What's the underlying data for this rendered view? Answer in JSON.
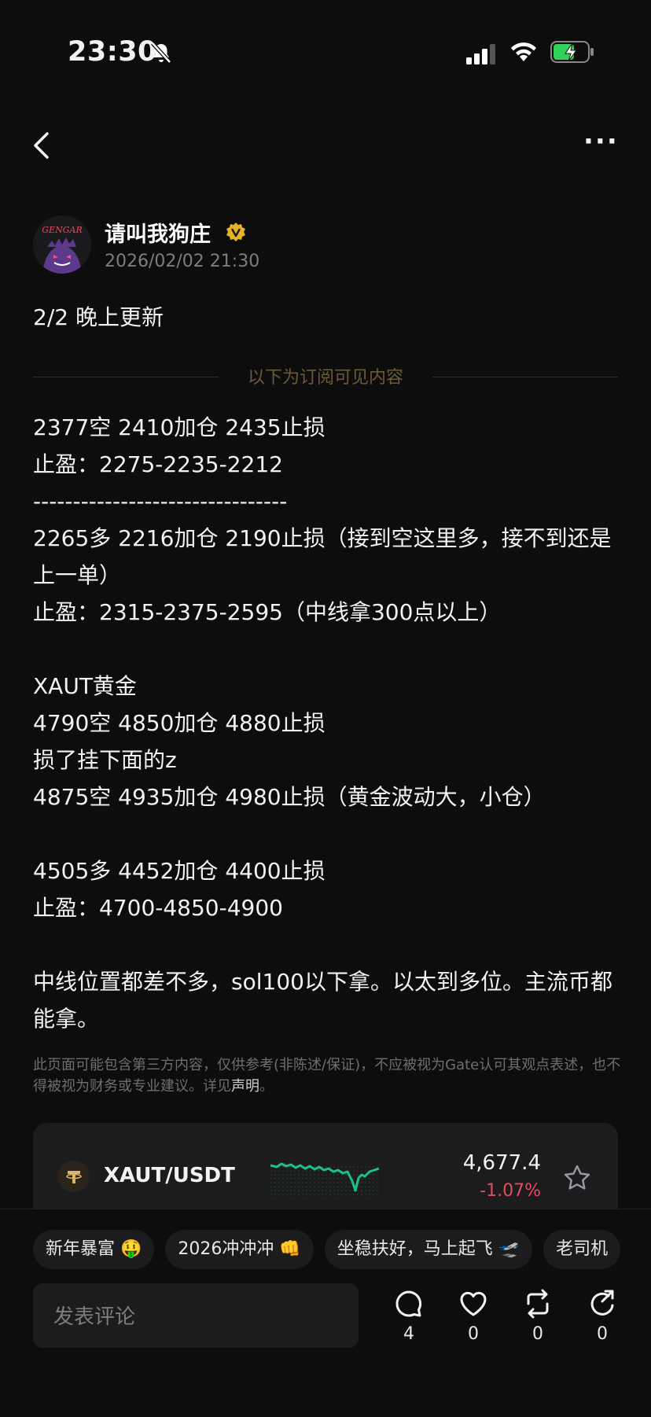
{
  "status_bar": {
    "time": "23:30"
  },
  "author": {
    "name": "请叫我狗庄",
    "avatar_text": "GENGAR",
    "timestamp": "2026/02/02 21:30"
  },
  "post": {
    "intro": "2/2 晚上更新",
    "subscriber_divider": "以下为订阅可见内容",
    "lines": [
      "2377空 2410加仓 2435止损",
      "止盈：2275-2235-2212",
      "--------------------------------",
      "2265多 2216加仓 2190止损（接到空这里多，接不到还是上一单）",
      "止盈：2315-2375-2595（中线拿300点以上）",
      "",
      "XAUT黄金",
      "4790空 4850加仓 4880止损",
      "损了挂下面的z",
      "4875空 4935加仓 4980止损（黄金波动大，小仓）",
      "",
      "4505多 4452加仓 4400止损",
      "止盈：4700-4850-4900",
      "",
      "中线位置都差不多，sol100以下拿。以太到多位。主流币都能拿。"
    ],
    "disclaimer": "此页面可能包含第三方内容，仅供参考(非陈述/保证)，不应被视为Gate认可其观点表述，也不得被视为财务或专业建议。详见",
    "disclaimer_link": "声明",
    "disclaimer_end": "。"
  },
  "ticker": {
    "pair": "XAUT/USDT",
    "price": "4,677.4",
    "change": "-1.07%",
    "change_color": "#e84a5f",
    "spark_color": "#1fbf86"
  },
  "chips": [
    "新年暴富 🤑",
    "2026冲冲冲 👊",
    "坐稳扶好，马上起飞 🛫",
    "老司机"
  ],
  "comment_placeholder": "发表评论",
  "actions": {
    "comments": "4",
    "likes": "0",
    "reposts": "0",
    "shares": "0"
  }
}
